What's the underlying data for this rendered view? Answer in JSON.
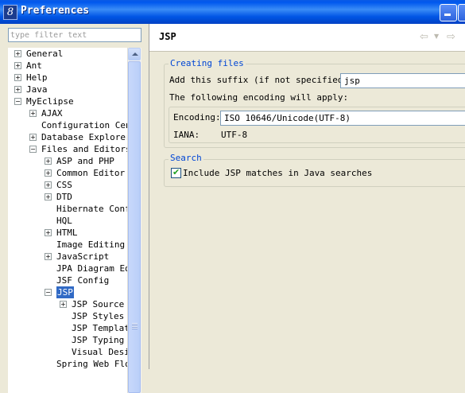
{
  "window": {
    "title": "Preferences",
    "icon": "eclipse-8-icon"
  },
  "filter": {
    "placeholder": "type filter text",
    "value": ""
  },
  "tree": [
    {
      "label": "General",
      "level": 0,
      "toggle": "+"
    },
    {
      "label": "Ant",
      "level": 0,
      "toggle": "+"
    },
    {
      "label": "Help",
      "level": 0,
      "toggle": "+"
    },
    {
      "label": "Java",
      "level": 0,
      "toggle": "+"
    },
    {
      "label": "MyEclipse",
      "level": 0,
      "toggle": "-"
    },
    {
      "label": "AJAX",
      "level": 1,
      "toggle": "+"
    },
    {
      "label": "Configuration Cent",
      "level": 1,
      "toggle": ""
    },
    {
      "label": "Database Explorer",
      "level": 1,
      "toggle": "+"
    },
    {
      "label": "Files and Editors",
      "level": 1,
      "toggle": "-"
    },
    {
      "label": "ASP and PHP",
      "level": 2,
      "toggle": "+"
    },
    {
      "label": "Common Editor P",
      "level": 2,
      "toggle": "+"
    },
    {
      "label": "CSS",
      "level": 2,
      "toggle": "+"
    },
    {
      "label": "DTD",
      "level": 2,
      "toggle": "+"
    },
    {
      "label": "Hibernate Confi",
      "level": 2,
      "toggle": ""
    },
    {
      "label": "HQL",
      "level": 2,
      "toggle": ""
    },
    {
      "label": "HTML",
      "level": 2,
      "toggle": "+"
    },
    {
      "label": "Image Editing",
      "level": 2,
      "toggle": ""
    },
    {
      "label": "JavaScript",
      "level": 2,
      "toggle": "+"
    },
    {
      "label": "JPA Diagram Edi",
      "level": 2,
      "toggle": ""
    },
    {
      "label": "JSF Config",
      "level": 2,
      "toggle": ""
    },
    {
      "label": "JSP",
      "level": 2,
      "toggle": "-",
      "selected": true
    },
    {
      "label": "JSP Source",
      "level": 3,
      "toggle": "+"
    },
    {
      "label": "JSP Styles",
      "level": 3,
      "toggle": ""
    },
    {
      "label": "JSP Template",
      "level": 3,
      "toggle": ""
    },
    {
      "label": "JSP Typing",
      "level": 3,
      "toggle": ""
    },
    {
      "label": "Visual Desi",
      "level": 3,
      "toggle": ""
    },
    {
      "label": "Spring Web Flov",
      "level": 2,
      "toggle": ""
    }
  ],
  "page": {
    "title": "JSP",
    "nav": {
      "back_icon": "⇦",
      "dropdown_icon": "▼",
      "forward_icon": "⇨"
    },
    "creating_files": {
      "label": "Creating files",
      "suffix_label": "Add this suffix (if not specified):",
      "suffix_value": "jsp",
      "encoding_note": "The following encoding will apply:",
      "encoding_label": "Encoding:",
      "encoding_value": "ISO 10646/Unicode(UTF-8)",
      "iana_label": "IANA:",
      "iana_value": "UTF-8"
    },
    "search": {
      "label": "Search",
      "include_label": "Include JSP matches in Java searches",
      "include_checked": true
    }
  },
  "colors": {
    "titlebar": "#0058ee",
    "selection": "#316ac5",
    "group_label": "#0046d5",
    "window_bg": "#ece9d8"
  }
}
